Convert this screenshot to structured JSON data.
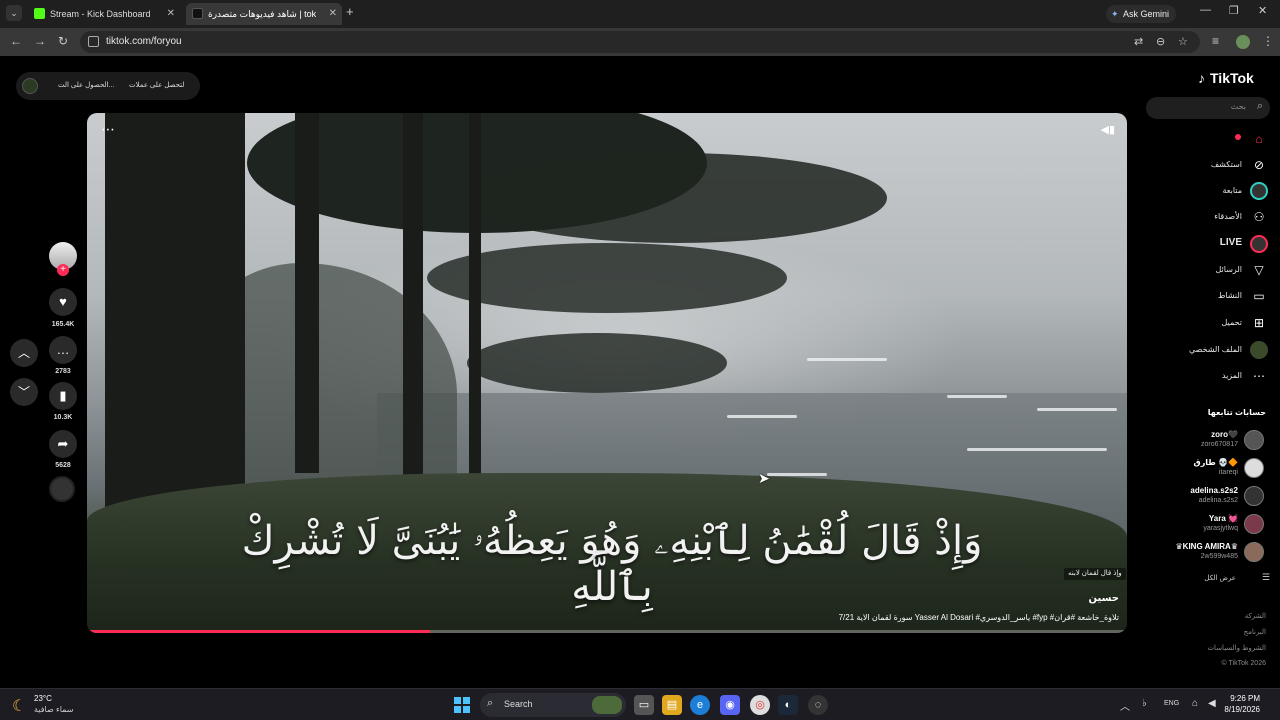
{
  "browser": {
    "tabs": [
      {
        "title": "Stream - Kick Dashboard",
        "favicon_color": "#53fc18"
      },
      {
        "title": "شاهد فيديوهات متصدرة | tok",
        "favicon_color": "#111111"
      }
    ],
    "ask_gemini": "Ask Gemini",
    "url": "tiktok.com/foryou"
  },
  "promo": {
    "item1": "الحصول على الت...",
    "item2": "لتحصل على عملات"
  },
  "video": {
    "verse": "وَإِذْ قَالَ لُقْمَٰنُ لِٱبْنِهِۦ وَهُوَ يَعِظُهُۥ يَٰبُنَىَّ لَا تُشْرِكْ بِٱللَّهِ",
    "chip": "وإذ قال لقمان لابنه",
    "author": "حسين",
    "caption": "سورة لقمان الاية 7/21 Yasser Al Dosari #ياسر_الدوسري #fyp #تلاوة_خاشعة #قران",
    "progress": 0.33
  },
  "actions": {
    "likes": "165.4K",
    "comments": "2783",
    "saves": "10.3K",
    "shares": "5628"
  },
  "sidebar": {
    "brand": "TikTok",
    "search_placeholder": "بحث",
    "nav": [
      {
        "label": "",
        "icon": "home-icon"
      },
      {
        "label": "استكشف",
        "icon": "compass-icon"
      },
      {
        "label": "متابعة",
        "icon": "following-icon"
      },
      {
        "label": "الأصدقاء",
        "icon": "friends-icon"
      },
      {
        "label": "LIVE",
        "icon": "live-icon"
      },
      {
        "label": "الرسائل",
        "icon": "messages-icon"
      },
      {
        "label": "النشاط",
        "icon": "activity-icon"
      },
      {
        "label": "تحميل",
        "icon": "upload-icon"
      },
      {
        "label": "الملف الشخصي",
        "icon": "profile-icon"
      },
      {
        "label": "المزيد",
        "icon": "more-icon"
      }
    ],
    "following_title": "حسابات تتابعها",
    "accounts": [
      {
        "name": "zoro🖤",
        "handle": "zoro670817"
      },
      {
        "name": "طارق 💀🔶",
        "handle": "itareqi"
      },
      {
        "name": "adelina.s2s2",
        "handle": "adelina.s2s2"
      },
      {
        "name": "Yara 💓",
        "handle": "yarasjytlwq"
      },
      {
        "name": "♛KING AMIRA♛",
        "handle": "2w599w485"
      }
    ],
    "see_all": "عرض الكل",
    "footer": [
      "الشركة",
      "البرنامج",
      "الشروط والسياسات",
      "© TikTok 2026"
    ]
  },
  "taskbar": {
    "temp": "23°C",
    "weather": "سماء صافية",
    "search_label": "Search",
    "lang": "ENG",
    "time": "9:26 PM",
    "date": "8/19/2026"
  }
}
